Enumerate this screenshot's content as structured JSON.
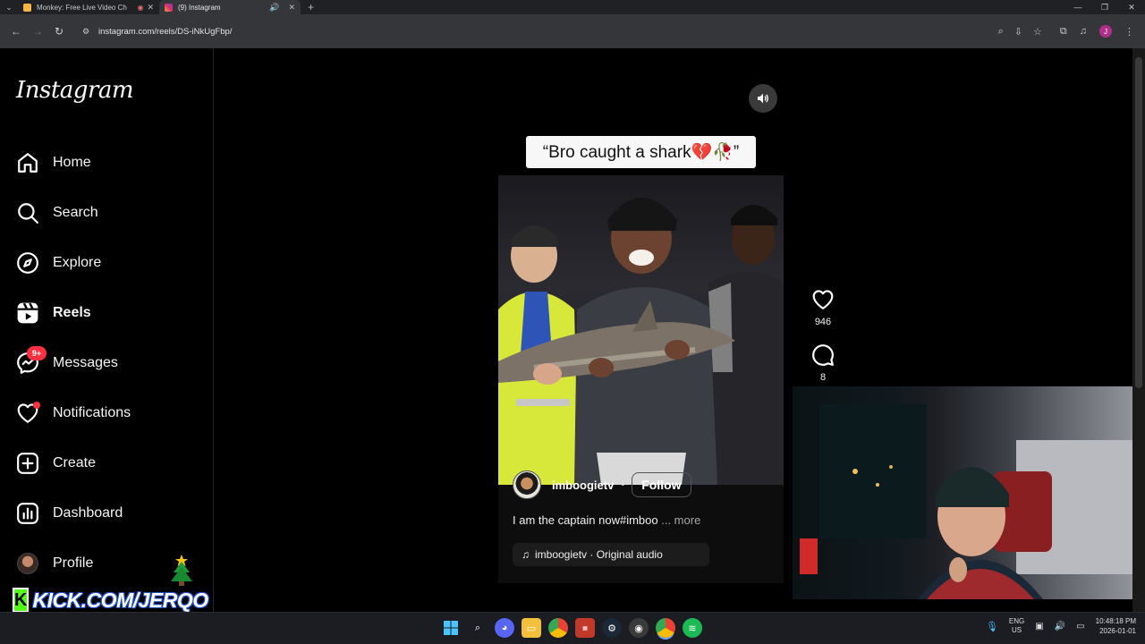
{
  "browser": {
    "tabs": [
      {
        "title": "Monkey: Free Live Video Ch",
        "favicon_color": "#f5b642",
        "active": false
      },
      {
        "title": "(9) Instagram",
        "favicon_color": "#e1306c",
        "active": true
      }
    ],
    "url": "instagram.com/reels/DS-iNkUgFbp/"
  },
  "sidebar": {
    "logo": "Instagram",
    "items": [
      {
        "label": "Home",
        "icon": "home-icon"
      },
      {
        "label": "Search",
        "icon": "search-icon"
      },
      {
        "label": "Explore",
        "icon": "compass-icon"
      },
      {
        "label": "Reels",
        "icon": "reels-icon",
        "active": true
      },
      {
        "label": "Messages",
        "icon": "messenger-icon",
        "badge": "9+"
      },
      {
        "label": "Notifications",
        "icon": "heart-icon",
        "dot": true
      },
      {
        "label": "Create",
        "icon": "plus-square-icon"
      },
      {
        "label": "Dashboard",
        "icon": "dashboard-icon"
      },
      {
        "label": "Profile",
        "icon": "avatar"
      }
    ]
  },
  "reel": {
    "caption_overlay": "“Bro caught a shark💔🥀”",
    "username": "imboogietv",
    "separator": "•",
    "follow_label": "Follow",
    "description": "I am the captain now#imboo",
    "more_label": "... more",
    "audio": "imboogietv · Original audio",
    "likes": "946",
    "comments": "8"
  },
  "overlay": {
    "stream_text": "KICK.COM/JERQO",
    "stream_logo": "K"
  },
  "taskbar": {
    "lang_top": "ENG",
    "lang_bottom": "US",
    "time": "10:48:18 PM",
    "date": "2026-01-01"
  },
  "colors": {
    "accent_red": "#ff3040",
    "kick_green": "#53fc18"
  }
}
